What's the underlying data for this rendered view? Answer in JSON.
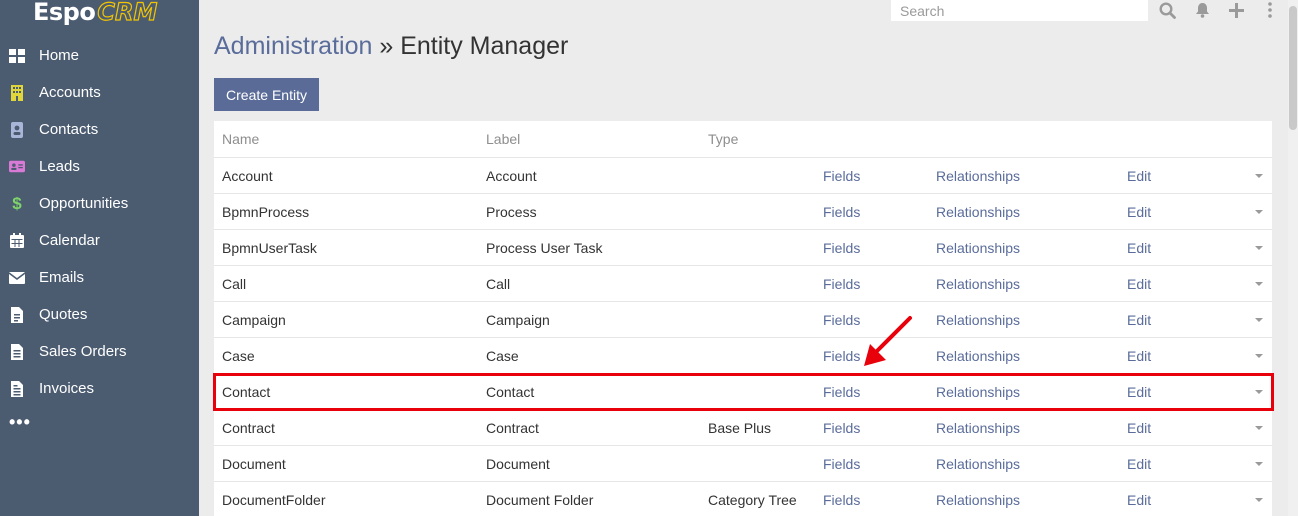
{
  "app": {
    "logo_main": "Espo",
    "logo_accent": "CRM"
  },
  "sidebar": {
    "items": [
      {
        "label": "Home",
        "icon": "th-large-icon",
        "color": "#ffffff"
      },
      {
        "label": "Accounts",
        "icon": "building-icon",
        "color": "#e0d53a"
      },
      {
        "label": "Contacts",
        "icon": "id-badge-icon",
        "color": "#a9b6d8"
      },
      {
        "label": "Leads",
        "icon": "address-card-icon",
        "color": "#d97ad6"
      },
      {
        "label": "Opportunities",
        "icon": "dollar-icon",
        "color": "#7ed36a"
      },
      {
        "label": "Calendar",
        "icon": "calendar-icon",
        "color": "#ffffff"
      },
      {
        "label": "Emails",
        "icon": "envelope-icon",
        "color": "#ffffff"
      },
      {
        "label": "Quotes",
        "icon": "file-invoice-icon",
        "color": "#ffffff"
      },
      {
        "label": "Sales Orders",
        "icon": "file-alt-icon",
        "color": "#ffffff"
      },
      {
        "label": "Invoices",
        "icon": "file-invoice-dollar-icon",
        "color": "#ffffff"
      }
    ],
    "more": "•••"
  },
  "topbar": {
    "search_placeholder": "Search"
  },
  "header": {
    "breadcrumb_root": "Administration",
    "separator": " » ",
    "title": "Entity Manager"
  },
  "toolbar": {
    "create_label": "Create Entity"
  },
  "table": {
    "columns": {
      "name": "Name",
      "label": "Label",
      "type": "Type"
    },
    "rows": [
      {
        "name": "Account",
        "label": "Account",
        "type": "",
        "fields": "Fields",
        "relationships": "Relationships",
        "edit": "Edit"
      },
      {
        "name": "BpmnProcess",
        "label": "Process",
        "type": "",
        "fields": "Fields",
        "relationships": "Relationships",
        "edit": "Edit"
      },
      {
        "name": "BpmnUserTask",
        "label": "Process User Task",
        "type": "",
        "fields": "Fields",
        "relationships": "Relationships",
        "edit": "Edit"
      },
      {
        "name": "Call",
        "label": "Call",
        "type": "",
        "fields": "Fields",
        "relationships": "Relationships",
        "edit": "Edit"
      },
      {
        "name": "Campaign",
        "label": "Campaign",
        "type": "",
        "fields": "Fields",
        "relationships": "Relationships",
        "edit": "Edit"
      },
      {
        "name": "Case",
        "label": "Case",
        "type": "",
        "fields": "Fields",
        "relationships": "Relationships",
        "edit": "Edit"
      },
      {
        "name": "Contact",
        "label": "Contact",
        "type": "",
        "fields": "Fields",
        "relationships": "Relationships",
        "edit": "Edit"
      },
      {
        "name": "Contract",
        "label": "Contract",
        "type": "Base Plus",
        "fields": "Fields",
        "relationships": "Relationships",
        "edit": "Edit"
      },
      {
        "name": "Document",
        "label": "Document",
        "type": "",
        "fields": "Fields",
        "relationships": "Relationships",
        "edit": "Edit"
      },
      {
        "name": "DocumentFolder",
        "label": "Document Folder",
        "type": "Category Tree",
        "fields": "Fields",
        "relationships": "Relationships",
        "edit": "Edit"
      }
    ]
  },
  "colors": {
    "sidebar_bg": "#4b5b70",
    "accent": "#5a6b98",
    "link": "#5a6c9a",
    "annotation": "#e8000b"
  }
}
